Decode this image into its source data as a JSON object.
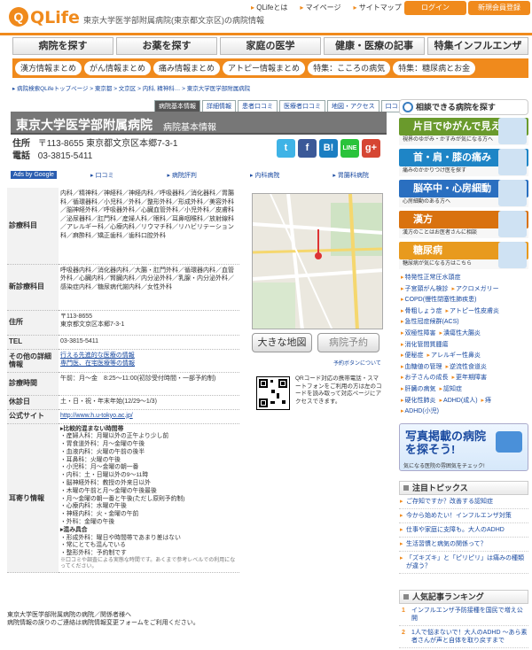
{
  "header": {
    "logo_text": "QLife",
    "tagline": "東京大学医学部附属病院(東京都文京区)の病院情報",
    "top_links": [
      "QLifeとは",
      "マイページ",
      "サイトマップ"
    ],
    "login": "ログイン",
    "register": "新規会員登録"
  },
  "main_nav": [
    "病院を探す",
    "お薬を探す",
    "家庭の医学",
    "健康・医療の記事",
    "特集インフルエンザ"
  ],
  "sub_nav": [
    "漢方情報まとめ",
    "がん情報まとめ",
    "痛み情報まとめ",
    "アトピー情報まとめ",
    "特集：こころの病気",
    "特集：糖尿病とお金"
  ],
  "breadcrumb": "▸ 病院検索QLifeトップページ  >  東京都  >  文京区  >  内科, 精神科…  >  東京大学医学部附属病院",
  "tabs": [
    "病院基本情報",
    "詳細情報",
    "患者口コミ",
    "医療者口コミ",
    "地図・アクセス",
    "口コミ投稿"
  ],
  "hospital": {
    "name": "東京大学医学部附属病院",
    "subtitle": "病院基本情報",
    "address_label": "住所",
    "address": "〒113-8655  東京都文京区本郷7-3-1",
    "phone_label": "電話",
    "phone": "03-3815-5411"
  },
  "ads": {
    "label": "Ads by Google",
    "links": [
      "▸ 口コミ",
      "▸ 病院評判",
      "▸ 内科病院",
      "▸ 胃腸科病院"
    ]
  },
  "table": [
    {
      "label": "診療科目",
      "value": "内科／精神科／神経科／神経内科／呼吸器科／消化器科／胃腸科／循環器科／小児科／外科／整形外科／形成外科／美容外科／脳神経外科／呼吸器外科／心臓血管外科／小児外科／皮膚科／泌尿器科／肛門科／産婦人科／眼科／耳鼻咽喉科／放射線科／アレルギー科／心療内科／リウマチ科／リハビリテーション科／麻酔科／矯正歯科／歯科口腔外科"
    },
    {
      "label": "新診療科目",
      "value": "呼吸器内科／消化器内科／大腸・肛門外科／循環器内科／血管外科／心臓内科／腎臓内科／内分泌外科／乳腺・内分泌外科／感染症内科／糖尿病代謝内科／女性外科"
    },
    {
      "label": "住所",
      "value": "〒113-8655\n東京都文京区本郷7-3-1"
    },
    {
      "label": "TEL",
      "value": "03-3815-5411"
    },
    {
      "label": "その他の詳細情報",
      "value": "行える先進的な医療の情報\n専門医、在宅医療等の情報"
    },
    {
      "label": "診療時間",
      "value": "午前：月〜金　8:25〜11:00(初診受付時間・一部予約制)"
    },
    {
      "label": "休診日",
      "value": "土・日・祝・年末年始(12/29〜1/3)"
    },
    {
      "label": "公式サイト",
      "value": "http://www.h.u-tokyo.ac.jp/"
    }
  ],
  "busy": {
    "label": "耳寄り情報",
    "title": "▸比較的混まない時間帯",
    "lines": [
      "・産婦人科：月曜以外の正午より少し前",
      "・胃食道外科：月〜金曜の午後",
      "・血液内科：火曜の午前の後半",
      "・耳鼻科：火曜の午後",
      "・小児科：月〜金曜の朝一番",
      "・内科：土・日曜以外の9〜11時",
      "・脳神経外科：教授の外来日以外",
      "・木曜の午前と月〜金曜の午後最後",
      "・月〜金曜の朝一番と午後(ただし原則予約制)",
      "・心療内科：水曜の午後",
      "・神経内科：火・金曜の午前",
      "・外科：金曜の午後"
    ],
    "title2": "▸混み具合",
    "lines2": [
      "・形成外科：曜日や時間帯であまり差はない",
      "・常にとても混んでいる",
      "・整形外科：予約制です"
    ],
    "note": "※口コミや調査による実態な時間です。あくまで参考レベルでの利用になってください。"
  },
  "footnote": "東京大学医学部附属病院の病院／関係者様へ\n病院情報の誤りのご連絡は病院情報変更フォームをご利用ください。",
  "map": {
    "btn_map": "大きな地図",
    "btn_reserve": "病院予約",
    "reserve_link": "予約ボタンについて",
    "qr_text": "QRコード対応の携帯電話・スマートフォンをご利用の方は左のコードを読み取って対応ページにアクセスできます。"
  },
  "right": {
    "title": "相談できる病院を探す",
    "cats": [
      {
        "label": "片目でゆがんで見える",
        "desc": "視界のゆがみ・かすみが気になる方へ",
        "color": "#6a9a2c"
      },
      {
        "label": "首・肩・膝の痛み",
        "desc": "痛みのかかりつけ医を探す",
        "color": "#1e85c6"
      },
      {
        "label": "脳卒中・心房細動",
        "desc": "心房細動のある方へ",
        "color": "#2a6fc0"
      },
      {
        "label": "漢方",
        "desc": "漢方のことはお医者さんに相談",
        "color": "#d9720f"
      },
      {
        "label": "糖尿病",
        "desc": "糖尿病が気になる方はこちら",
        "color": "#e89a1e"
      }
    ],
    "links": [
      "特発性正常圧水頭症",
      "子宮頸がん検診",
      "アクロメガリー",
      "COPD(慢性閉塞性肺疾患)",
      "骨粗しょう症",
      "アトピー性皮膚炎",
      "急性冠症候群(ACS)",
      "双極性障害",
      "潰瘍性大腸炎",
      "消化管間質腫瘍",
      "便秘症",
      "アレルギー性鼻炎",
      "血糖値の管理",
      "逆流性食道炎",
      "お子さんの成長",
      "更年期障害",
      "肝臓の病気",
      "認知症",
      "硬化性肺炎",
      "ADHD(成人)",
      "痔",
      "ADHD(小児)"
    ],
    "banner": "写真掲載の病院を探そう!",
    "banner_sub": "気になる医院の雰囲気をチェック!",
    "topics_title": "注目トピックス",
    "topics": [
      "ご存知ですか？改善する認知症",
      "今から始めたい！インフルエンザ対策",
      "仕事や家庭に支障も。大人のADHD",
      "生活習慣と病気の関係って？",
      "「ズキズキ」と「ピリピリ」は痛みの種類が違う？"
    ],
    "rank_title": "人気記事ランキング",
    "rank": [
      "インフルエンザ予防接種を国民で増え公開",
      "1人で悩まないで！大人のADHD ～あら素者さんが声と自体を取り戻すまで"
    ]
  },
  "colors": {
    "accent": "#f08a1c",
    "link": "#1a4aa0"
  }
}
